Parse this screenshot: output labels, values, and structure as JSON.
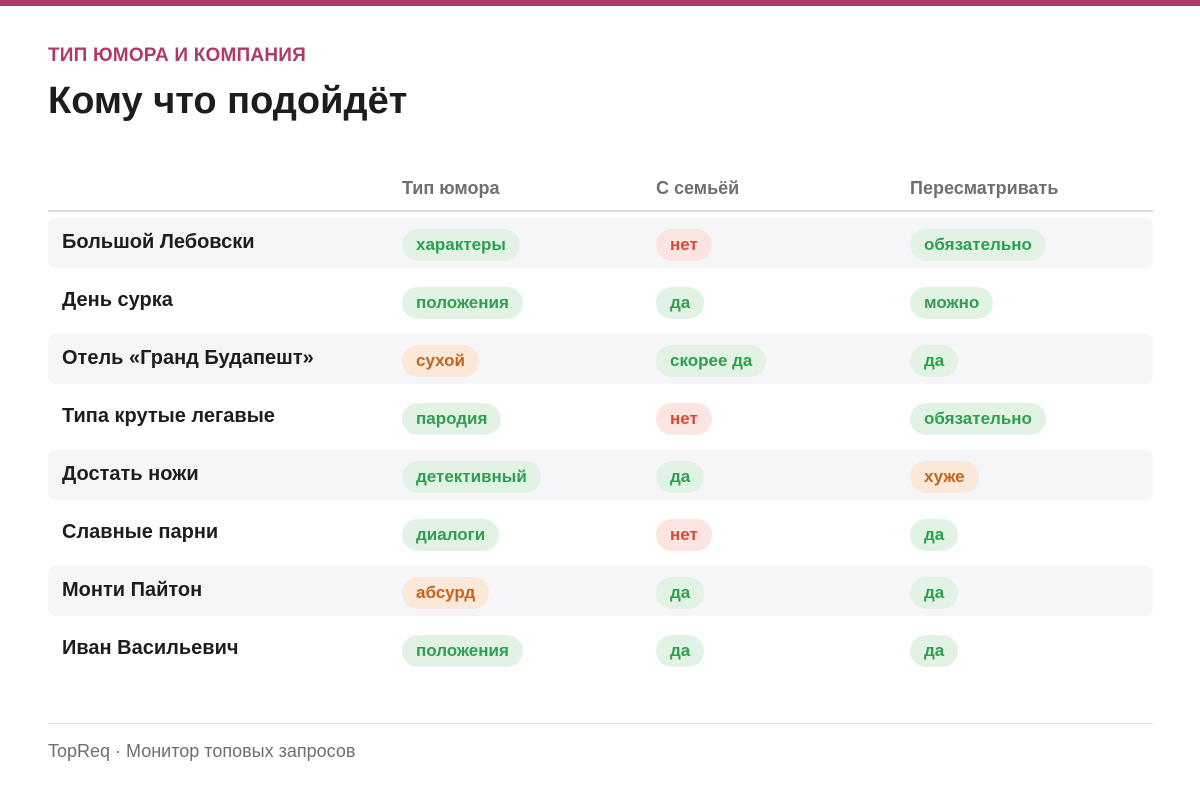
{
  "header": {
    "kicker": "ТИП ЮМОРА И КОМПАНИЯ",
    "title": "Кому что подойдёт"
  },
  "colors": {
    "accent": "#b03a67",
    "green": "#2e9e4f",
    "red": "#d9483b",
    "orange": "#c0651e"
  },
  "table": {
    "columns": [
      "",
      "Тип юмора",
      "С семьёй",
      "Пересматривать"
    ],
    "rows": [
      {
        "title": "Большой Лебовски",
        "humor": "характеры",
        "humor_tone": "green",
        "family": "нет",
        "family_tone": "red",
        "rewatch": "обязательно",
        "rewatch_tone": "green"
      },
      {
        "title": "День сурка",
        "humor": "положения",
        "humor_tone": "green",
        "family": "да",
        "family_tone": "green",
        "rewatch": "можно",
        "rewatch_tone": "green"
      },
      {
        "title": "Отель «Гранд Будапешт»",
        "humor": "сухой",
        "humor_tone": "orange",
        "family": "скорее да",
        "family_tone": "green",
        "rewatch": "да",
        "rewatch_tone": "green"
      },
      {
        "title": "Типа крутые легавые",
        "humor": "пародия",
        "humor_tone": "green",
        "family": "нет",
        "family_tone": "red",
        "rewatch": "обязательно",
        "rewatch_tone": "green"
      },
      {
        "title": "Достать ножи",
        "humor": "детективный",
        "humor_tone": "green",
        "family": "да",
        "family_tone": "green",
        "rewatch": "хуже",
        "rewatch_tone": "orange"
      },
      {
        "title": "Славные парни",
        "humor": "диалоги",
        "humor_tone": "green",
        "family": "нет",
        "family_tone": "red",
        "rewatch": "да",
        "rewatch_tone": "green"
      },
      {
        "title": "Монти Пайтон",
        "humor": "абсурд",
        "humor_tone": "orange",
        "family": "да",
        "family_tone": "green",
        "rewatch": "да",
        "rewatch_tone": "green"
      },
      {
        "title": "Иван Васильевич",
        "humor": "положения",
        "humor_tone": "green",
        "family": "да",
        "family_tone": "green",
        "rewatch": "да",
        "rewatch_tone": "green"
      }
    ]
  },
  "footer": {
    "text": "TopReq · Монитор топовых запросов"
  }
}
